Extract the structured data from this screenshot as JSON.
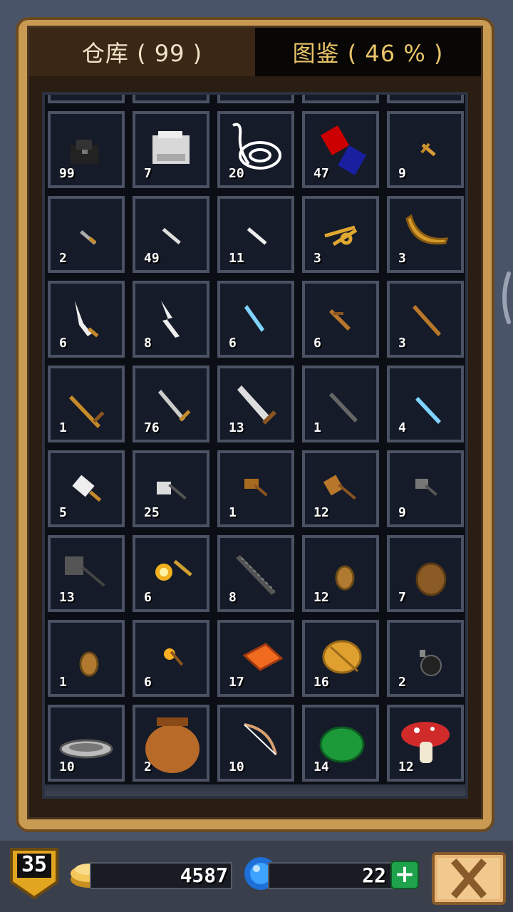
{
  "tabs": {
    "warehouse_label": "仓库 ( 99 )",
    "catalog_label": "图鉴 ( 46 % )"
  },
  "inventory": {
    "rows": [
      [
        {
          "icon": "ore-coal-icon",
          "count": "99"
        },
        {
          "icon": "stone-icon",
          "count": "7"
        },
        {
          "icon": "string-icon",
          "count": "20"
        },
        {
          "icon": "magnet-icon",
          "count": "47"
        },
        {
          "icon": "tiny-dagger-icon",
          "count": "9"
        }
      ],
      [
        {
          "icon": "small-knife-icon",
          "count": "2"
        },
        {
          "icon": "iron-knife-icon",
          "count": "49"
        },
        {
          "icon": "steel-knife-icon",
          "count": "11"
        },
        {
          "icon": "scissors-icon",
          "count": "3"
        },
        {
          "icon": "boomerang-icon",
          "count": "3"
        }
      ],
      [
        {
          "icon": "curved-blade-icon",
          "count": "6"
        },
        {
          "icon": "jagged-blade-icon",
          "count": "8"
        },
        {
          "icon": "ice-dagger-icon",
          "count": "6"
        },
        {
          "icon": "wooden-dagger-icon",
          "count": "6"
        },
        {
          "icon": "wooden-short-sword-icon",
          "count": "3"
        }
      ],
      [
        {
          "icon": "wooden-sword-icon",
          "count": "1"
        },
        {
          "icon": "iron-sword-icon",
          "count": "76"
        },
        {
          "icon": "great-sword-icon",
          "count": "13"
        },
        {
          "icon": "dark-sword-icon",
          "count": "1"
        },
        {
          "icon": "ice-sword-icon",
          "count": "4"
        }
      ],
      [
        {
          "icon": "cleaver-icon",
          "count": "5"
        },
        {
          "icon": "battle-axe-icon",
          "count": "25"
        },
        {
          "icon": "wooden-hammer-icon",
          "count": "1"
        },
        {
          "icon": "mallet-icon",
          "count": "12"
        },
        {
          "icon": "iron-hammer-icon",
          "count": "9"
        }
      ],
      [
        {
          "icon": "war-hammer-icon",
          "count": "13"
        },
        {
          "icon": "spark-wand-icon",
          "count": "6"
        },
        {
          "icon": "serrated-sword-icon",
          "count": "8"
        },
        {
          "icon": "small-shield-icon",
          "count": "12"
        },
        {
          "icon": "round-shield-icon",
          "count": "7"
        }
      ],
      [
        {
          "icon": "buckler-icon",
          "count": "1"
        },
        {
          "icon": "torch-icon",
          "count": "6"
        },
        {
          "icon": "copper-ingot-icon",
          "count": "17"
        },
        {
          "icon": "golden-leaf-icon",
          "count": "16"
        },
        {
          "icon": "bomb-icon",
          "count": "2"
        }
      ],
      [
        {
          "icon": "pan-icon",
          "count": "10"
        },
        {
          "icon": "clay-pot-icon",
          "count": "2"
        },
        {
          "icon": "bow-icon",
          "count": "10"
        },
        {
          "icon": "herb-leaf-icon",
          "count": "14"
        },
        {
          "icon": "mushroom-icon",
          "count": "12"
        }
      ]
    ]
  },
  "status": {
    "level": "35",
    "gold": "4587",
    "gems": "22"
  },
  "colors": {
    "panel_gold": "#c89a52",
    "slot_bg": "#151b28",
    "slot_border": "#4a5264",
    "tab_active_text": "#f0e4c8",
    "tab_inactive_text": "#e9c46a"
  }
}
